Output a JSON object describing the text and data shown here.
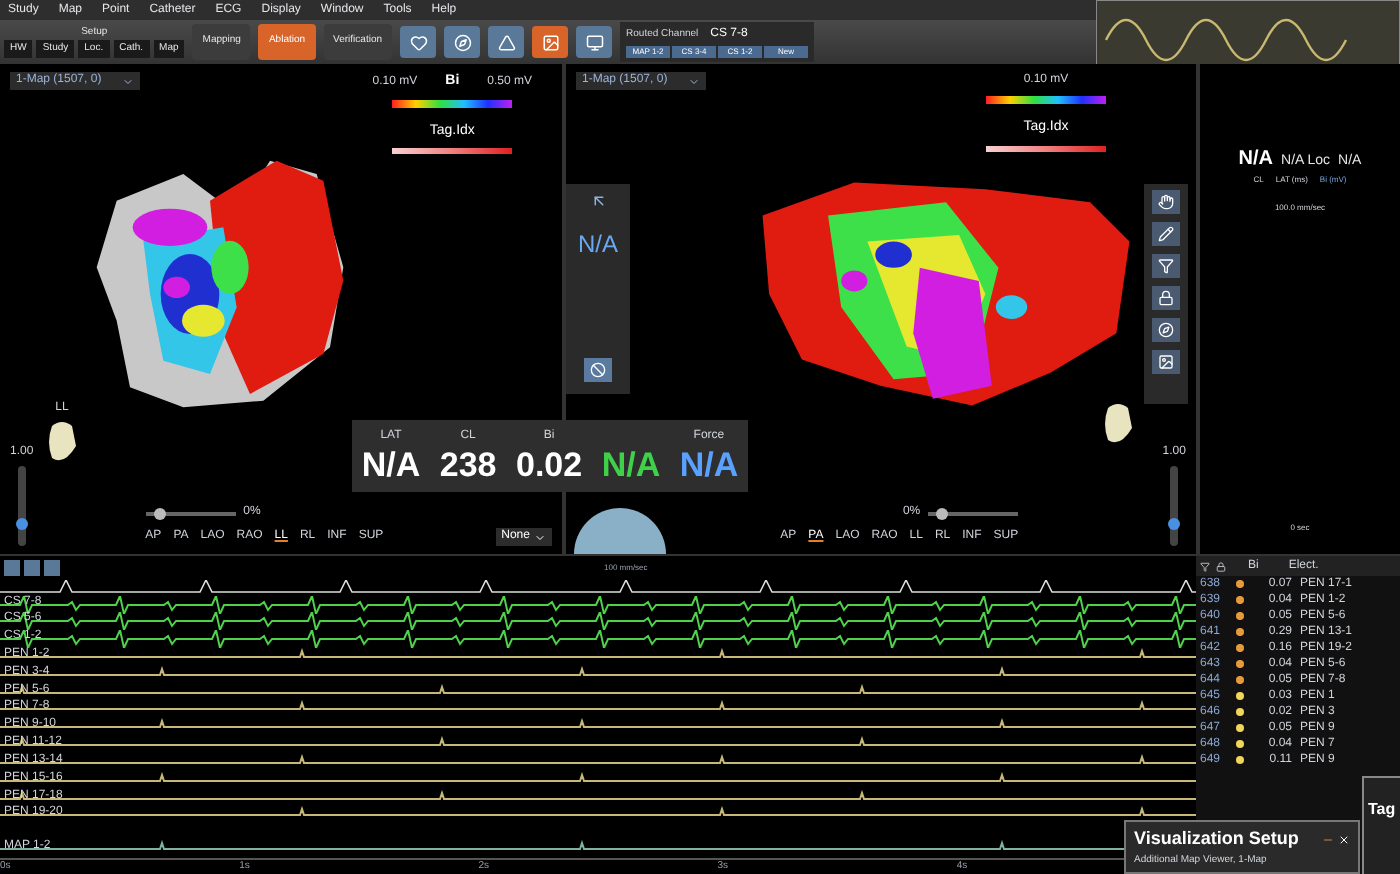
{
  "menu": [
    "Study",
    "Map",
    "Point",
    "Catheter",
    "ECG",
    "Display",
    "Window",
    "Tools",
    "Help"
  ],
  "setup": {
    "title": "Setup",
    "tabs": [
      "HW",
      "Study",
      "Loc.",
      "Cath.",
      "Map"
    ]
  },
  "modes": [
    {
      "label": "Mapping",
      "selected": false
    },
    {
      "label": "Ablation",
      "selected": true
    },
    {
      "label": "Verification",
      "selected": false
    }
  ],
  "routed_channel": {
    "label": "Routed Channel",
    "value": "CS 7-8",
    "buttons": [
      "MAP 1-2",
      "CS 3-4",
      "CS 1-2",
      "New"
    ]
  },
  "maps": [
    {
      "map": "1-Map (1507, 0)",
      "scale_min": "0.10 mV",
      "scale_name": "Bi",
      "scale_max": "0.50 mV",
      "tag": "Tag.Idx",
      "zoom": "1.00",
      "zoom_slider": {
        "level": 0.25
      },
      "orientation": "LL",
      "percent": "0%",
      "opacity_slider": {
        "level": 0.1
      },
      "filter": "None",
      "views": [
        {
          "label": "AP",
          "selected": false
        },
        {
          "label": "PA",
          "selected": false
        },
        {
          "label": "LAO",
          "selected": false
        },
        {
          "label": "RAO",
          "selected": false
        },
        {
          "label": "LL",
          "selected": true
        },
        {
          "label": "RL",
          "selected": false
        },
        {
          "label": "INF",
          "selected": false
        },
        {
          "label": "SUP",
          "selected": false
        }
      ]
    },
    {
      "map": "1-Map (1507, 0)",
      "scale_min": "0.10 mV",
      "tag": "Tag.Idx",
      "zoom": "1.00",
      "zoom_slider": {
        "level": 0.25
      },
      "percent": "0%",
      "opacity_slider": {
        "level": 0.1
      },
      "tool_value": "N/A",
      "views": [
        {
          "label": "AP",
          "selected": false
        },
        {
          "label": "PA",
          "selected": true
        },
        {
          "label": "LAO",
          "selected": false
        },
        {
          "label": "RAO",
          "selected": false
        },
        {
          "label": "LL",
          "selected": false
        },
        {
          "label": "RL",
          "selected": false
        },
        {
          "label": "INF",
          "selected": false
        },
        {
          "label": "SUP",
          "selected": false
        }
      ]
    }
  ],
  "readout": [
    {
      "label": "LAT",
      "value": "N/A",
      "color": "#ffffff"
    },
    {
      "label": "CL",
      "value": "238",
      "color": "#ffffff"
    },
    {
      "label": "Bi",
      "value": "0.02",
      "color": "#ffffff"
    },
    {
      "value": "N/A",
      "color": "#3fd14a"
    },
    {
      "label": "Force",
      "value": "N/A",
      "color": "#5aa0ff"
    }
  ],
  "side_panel": {
    "values": [
      "N/A",
      "N/A Loc",
      "N/A"
    ],
    "labels": [
      "CL",
      "LAT (ms)",
      "Bi (mV)"
    ],
    "speed": "100.0 mm/sec",
    "time": "0 sec"
  },
  "ecg": {
    "speed": "100 mm/sec",
    "time_ticks": [
      "0s",
      "1s",
      "2s",
      "3s",
      "4s"
    ],
    "channels": [
      {
        "name": "CS 7-8",
        "color": "#4fd04a"
      },
      {
        "name": "CS 5-6",
        "color": "#4fd04a"
      },
      {
        "name": "CS 1-2",
        "color": "#4fd04a"
      },
      {
        "name": "PEN 1-2",
        "color": "#c8b878"
      },
      {
        "name": "PEN 3-4",
        "color": "#c8b878"
      },
      {
        "name": "PEN 5-6",
        "color": "#c8b878"
      },
      {
        "name": "PEN 7-8",
        "color": "#c8b878"
      },
      {
        "name": "PEN 9-10",
        "color": "#c8b878"
      },
      {
        "name": "PEN 11-12",
        "color": "#c8b878"
      },
      {
        "name": "PEN 13-14",
        "color": "#c8b878"
      },
      {
        "name": "PEN 15-16",
        "color": "#c8b878"
      },
      {
        "name": "PEN 17-18",
        "color": "#c8b878"
      },
      {
        "name": "PEN 19-20",
        "color": "#c8b878"
      },
      {
        "name": "MAP 1-2",
        "color": "#7fb0a0"
      }
    ]
  },
  "points_table": {
    "columns": [
      "Bi",
      "Elect."
    ],
    "rows": [
      {
        "id": "638",
        "color": "#e89a3c",
        "bi": "0.07",
        "elect": "PEN 17-1"
      },
      {
        "id": "639",
        "color": "#e89a3c",
        "bi": "0.04",
        "elect": "PEN 1-2"
      },
      {
        "id": "640",
        "color": "#e89a3c",
        "bi": "0.05",
        "elect": "PEN 5-6"
      },
      {
        "id": "641",
        "color": "#e89a3c",
        "bi": "0.29",
        "elect": "PEN 13-1"
      },
      {
        "id": "642",
        "color": "#e89a3c",
        "bi": "0.16",
        "elect": "PEN 19-2"
      },
      {
        "id": "643",
        "color": "#e89a3c",
        "bi": "0.04",
        "elect": "PEN 5-6"
      },
      {
        "id": "644",
        "color": "#e89a3c",
        "bi": "0.05",
        "elect": "PEN 7-8"
      },
      {
        "id": "645",
        "color": "#f2d65a",
        "bi": "0.03",
        "elect": "PEN 1"
      },
      {
        "id": "646",
        "color": "#f2d65a",
        "bi": "0.02",
        "elect": "PEN 3"
      },
      {
        "id": "647",
        "color": "#f2d65a",
        "bi": "0.05",
        "elect": "PEN 9"
      },
      {
        "id": "648",
        "color": "#f2d65a",
        "bi": "0.04",
        "elect": "PEN 7"
      },
      {
        "id": "649",
        "color": "#f2d65a",
        "bi": "0.11",
        "elect": "PEN 9"
      }
    ]
  },
  "dialog": {
    "title": "Visualization Setup",
    "subtitle": "Additional Map Viewer, 1-Map"
  },
  "tag_panel": {
    "title": "Tag"
  }
}
